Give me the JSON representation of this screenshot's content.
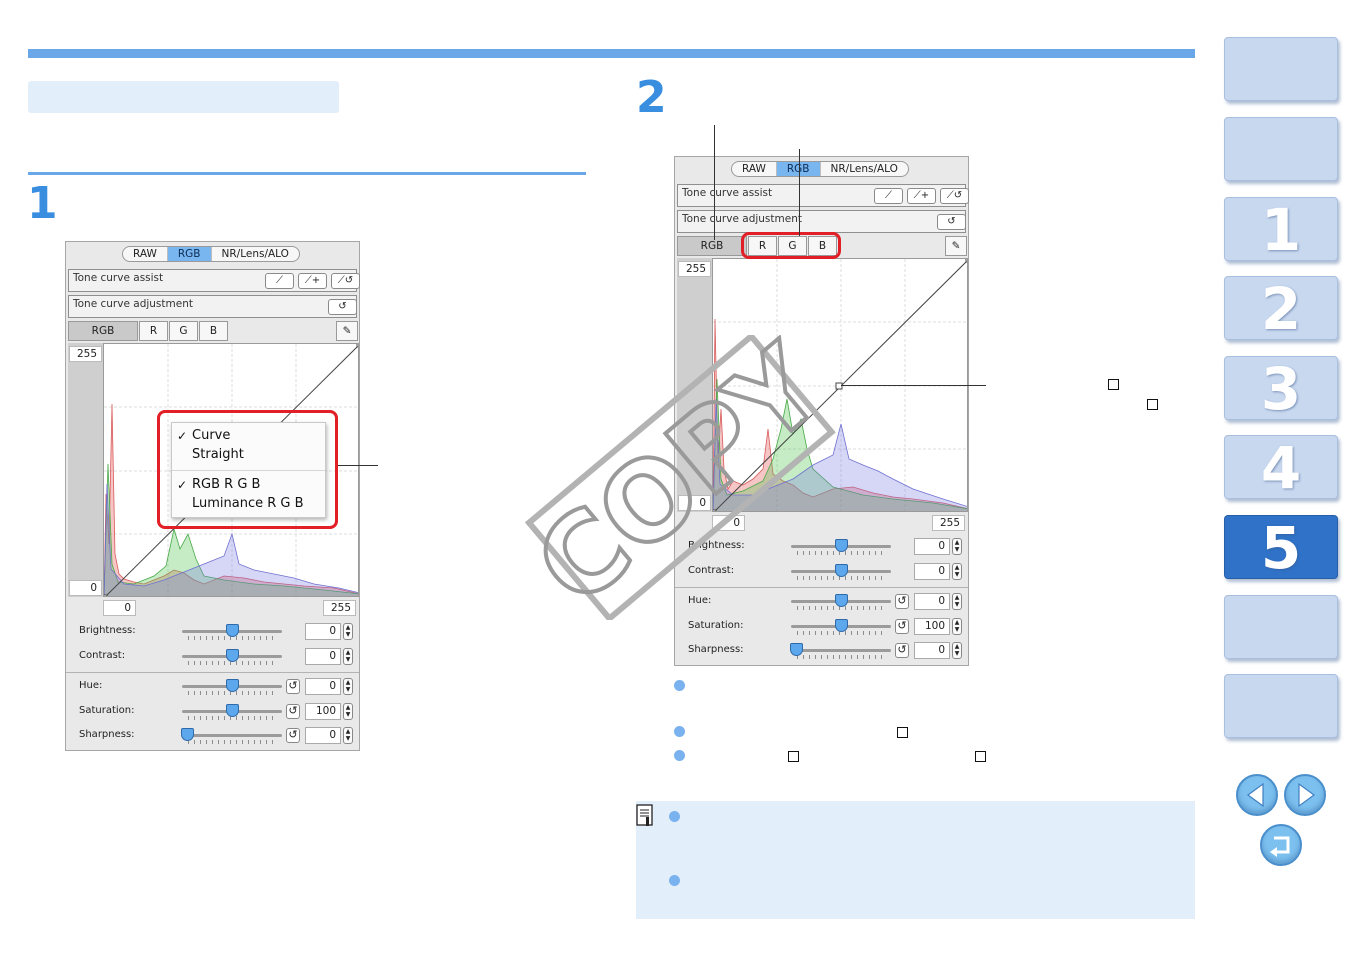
{
  "steps": {
    "step1": "1",
    "step2": "2"
  },
  "panel": {
    "tabs": [
      "RAW",
      "RGB",
      "NR/Lens/ALO"
    ],
    "active_tab": "RGB",
    "tone_curve_assist_label": "Tone curve assist",
    "tone_curve_adjustment_label": "Tone curve adjustment",
    "channels": [
      "RGB",
      "R",
      "G",
      "B"
    ],
    "plot": {
      "y_max": "255",
      "y_min": "0",
      "x_min": "0",
      "x_max": "255"
    },
    "sliders": [
      {
        "label": "Brightness:",
        "value": "0",
        "position": 0.5,
        "reset": false
      },
      {
        "label": "Contrast:",
        "value": "0",
        "position": 0.5,
        "reset": false
      },
      {
        "label": "Hue:",
        "value": "0",
        "position": 0.5,
        "reset": true
      },
      {
        "label": "Saturation:",
        "value": "100",
        "position": 0.5,
        "reset": true
      },
      {
        "label": "Sharpness:",
        "value": "0",
        "position": 0.0,
        "reset": true
      }
    ]
  },
  "popup_menu": {
    "items": [
      {
        "label": "Curve",
        "checked": true
      },
      {
        "label": "Straight",
        "checked": false
      },
      {
        "label": "RGB R G B",
        "checked": true
      },
      {
        "label": "Luminance R G B",
        "checked": false
      }
    ]
  },
  "watermark": "COPY",
  "nav": {
    "buttons": [
      "",
      "",
      "1",
      "2",
      "3",
      "4",
      "5",
      ""
    ],
    "active": "5"
  },
  "colors": {
    "accent_blue": "#6aa7e8",
    "highlight_red": "#e21e26",
    "active_nav": "#2f72c7",
    "nav_button": "#c8d8ef"
  },
  "icons": [
    "back-arrow-icon",
    "forward-arrow-icon",
    "return-icon",
    "memo-icon",
    "eyedropper-icon",
    "reset-icon"
  ]
}
